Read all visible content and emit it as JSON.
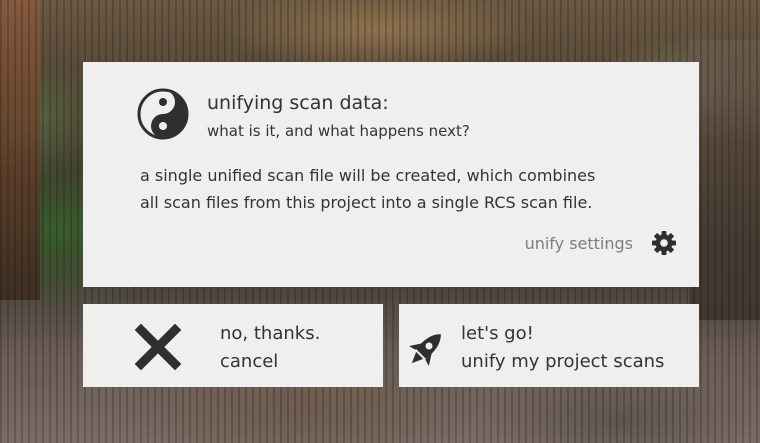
{
  "info": {
    "title": "unifying scan data:",
    "subtitle": "what is it, and what happens next?",
    "body_line1": "a single unified scan file will be created, which combines",
    "body_line2": "all scan files from this project into a single RCS scan file.",
    "settings_label": "unify settings",
    "icon": "yin-yang-icon",
    "settings_icon": "gear-icon"
  },
  "actions": {
    "cancel": {
      "line1": "no, thanks.",
      "line2": "cancel",
      "icon": "close-x-icon"
    },
    "go": {
      "line1": "let's go!",
      "line2": "unify my project scans",
      "icon": "rocket-icon"
    }
  },
  "colors": {
    "panel_bg": "#efefef",
    "text": "#333333",
    "muted_text": "#7d7d7d",
    "icon": "#2f2f2f"
  }
}
